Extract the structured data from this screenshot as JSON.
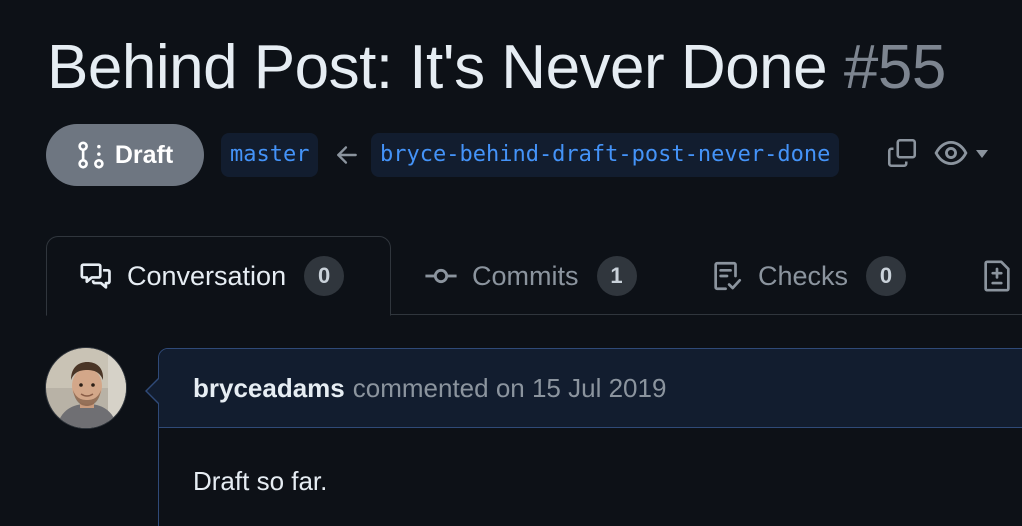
{
  "pr": {
    "title": "Behind Post: It's Never Done",
    "number": "#55",
    "state": "Draft",
    "base_branch": "master",
    "head_branch": "bryce-behind-draft-post-never-done"
  },
  "tabs": [
    {
      "label": "Conversation",
      "count": "0",
      "icon": "comment-discussion-icon",
      "active": true
    },
    {
      "label": "Commits",
      "count": "1",
      "icon": "git-commit-icon",
      "active": false
    },
    {
      "label": "Checks",
      "count": "0",
      "icon": "checklist-icon",
      "active": false
    },
    {
      "label": "",
      "count": "",
      "icon": "file-diff-icon",
      "active": false
    }
  ],
  "comment": {
    "author": "bryceadams",
    "action": "commented on 15 Jul 2019",
    "body": "Draft so far."
  },
  "colors": {
    "background": "#0d1117",
    "draft_badge": "#6e7681",
    "branch_text": "#4493f8",
    "comment_header_bg": "#121d2f",
    "comment_border": "#2f4a78"
  }
}
